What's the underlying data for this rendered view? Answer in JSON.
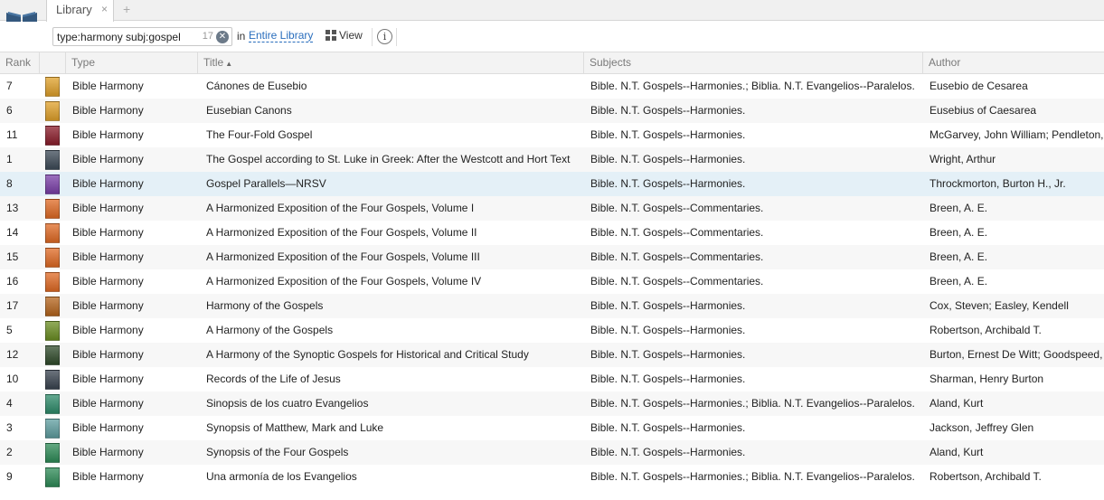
{
  "app": {
    "icon": "library-book-icon",
    "tab_label": "Library",
    "tab_close": "×",
    "tab_add": "+"
  },
  "toolbar": {
    "search_value": "type:harmony subj:gospel",
    "result_count": "17",
    "clear_glyph": "✕",
    "in_label": "in",
    "scope": "Entire Library",
    "view_label": "View",
    "info_glyph": "i"
  },
  "columns": {
    "rank": "Rank",
    "cover": "",
    "type": "Type",
    "title": "Title",
    "title_sort": "▲",
    "subjects": "Subjects",
    "author": "Author"
  },
  "rows": [
    {
      "rank": "7",
      "type": "Bible Harmony",
      "title": "Cánones de Eusebio",
      "subjects": "Bible. N.T. Gospels--Harmonies.; Biblia. N.T. Evangelios--Paralelos.",
      "author": "Eusebio de Cesarea",
      "cover_color": "#e0a12a"
    },
    {
      "rank": "6",
      "type": "Bible Harmony",
      "title": "Eusebian Canons",
      "subjects": "Bible. N.T. Gospels--Harmonies.",
      "author": "Eusebius of Caesarea",
      "cover_color": "#e0a12a"
    },
    {
      "rank": "11",
      "type": "Bible Harmony",
      "title": "The Four-Fold Gospel",
      "subjects": "Bible. N.T. Gospels--Harmonies.",
      "author": "McGarvey, John William; Pendleton,",
      "cover_color": "#8a1c2a"
    },
    {
      "rank": "1",
      "type": "Bible Harmony",
      "title": "The Gospel according to St. Luke in Greek: After the Westcott and Hort Text",
      "subjects": "Bible. N.T. Gospels--Harmonies.",
      "author": "Wright, Arthur",
      "cover_color": "#3d4a57"
    },
    {
      "rank": "8",
      "type": "Bible Harmony",
      "title": "Gospel Parallels—NRSV",
      "subjects": "Bible. N.T. Gospels--Harmonies.",
      "author": "Throckmorton, Burton H., Jr.",
      "cover_color": "#7a3fa8"
    },
    {
      "rank": "13",
      "type": "Bible Harmony",
      "title": "A Harmonized Exposition of the Four Gospels, Volume I",
      "subjects": "Bible. N.T. Gospels--Commentaries.",
      "author": "Breen, A. E.",
      "cover_color": "#e06a24"
    },
    {
      "rank": "14",
      "type": "Bible Harmony",
      "title": "A Harmonized Exposition of the Four Gospels, Volume II",
      "subjects": "Bible. N.T. Gospels--Commentaries.",
      "author": "Breen, A. E.",
      "cover_color": "#e06a24"
    },
    {
      "rank": "15",
      "type": "Bible Harmony",
      "title": "A Harmonized Exposition of the Four Gospels, Volume III",
      "subjects": "Bible. N.T. Gospels--Commentaries.",
      "author": "Breen, A. E.",
      "cover_color": "#e06a24"
    },
    {
      "rank": "16",
      "type": "Bible Harmony",
      "title": "A Harmonized Exposition of the Four Gospels, Volume IV",
      "subjects": "Bible. N.T. Gospels--Commentaries.",
      "author": "Breen, A. E.",
      "cover_color": "#e06a24"
    },
    {
      "rank": "17",
      "type": "Bible Harmony",
      "title": "Harmony of the Gospels",
      "subjects": "Bible. N.T. Gospels--Harmonies.",
      "author": "Cox, Steven; Easley, Kendell",
      "cover_color": "#b5651d"
    },
    {
      "rank": "5",
      "type": "Bible Harmony",
      "title": "A Harmony of the Gospels",
      "subjects": "Bible. N.T. Gospels--Harmonies.",
      "author": "Robertson, Archibald T.",
      "cover_color": "#6b8e23"
    },
    {
      "rank": "12",
      "type": "Bible Harmony",
      "title": "A Harmony of the Synoptic Gospels for Historical and Critical Study",
      "subjects": "Bible. N.T. Gospels--Harmonies.",
      "author": "Burton, Ernest De Witt; Goodspeed,",
      "cover_color": "#2f4a2a"
    },
    {
      "rank": "10",
      "type": "Bible Harmony",
      "title": "Records of the Life of Jesus",
      "subjects": "Bible. N.T. Gospels--Harmonies.",
      "author": "Sharman, Henry Burton",
      "cover_color": "#3a4450"
    },
    {
      "rank": "4",
      "type": "Bible Harmony",
      "title": "Sinopsis de los cuatro Evangelios",
      "subjects": "Bible. N.T. Gospels--Harmonies.; Biblia. N.T. Evangelios--Paralelos.",
      "author": "Aland, Kurt",
      "cover_color": "#2e8b6a"
    },
    {
      "rank": "3",
      "type": "Bible Harmony",
      "title": "Synopsis of Matthew, Mark and Luke",
      "subjects": "Bible. N.T. Gospels--Harmonies.",
      "author": "Jackson, Jeffrey Glen",
      "cover_color": "#5f9ea0"
    },
    {
      "rank": "2",
      "type": "Bible Harmony",
      "title": "Synopsis of the Four Gospels",
      "subjects": "Bible. N.T. Gospels--Harmonies.",
      "author": "Aland, Kurt",
      "cover_color": "#2e8b57"
    },
    {
      "rank": "9",
      "type": "Bible Harmony",
      "title": "Una armonía de los Evangelios",
      "subjects": "Bible. N.T. Gospels--Harmonies.; Biblia. N.T. Evangelios--Paralelos.",
      "author": "Robertson, Archibald T.",
      "cover_color": "#2e8b57"
    }
  ],
  "selected_rank": "8",
  "colors": {
    "accent_link": "#2a6ebd",
    "selected_row": "#e4f0f7"
  }
}
